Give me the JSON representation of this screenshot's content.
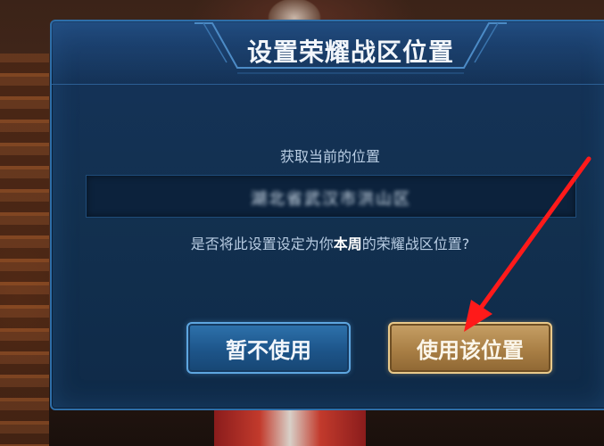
{
  "dialog": {
    "title": "设置荣耀战区位置",
    "prompt": "获取当前的位置",
    "location_value": "湖北省武汉市洪山区",
    "question_prefix": "是否将此设置设定为你",
    "question_highlight": "本周",
    "question_suffix": "的荣耀战区位置?",
    "cancel_label": "暂不使用",
    "confirm_label": "使用该位置"
  },
  "colors": {
    "dialog_bg": "#12304f",
    "dialog_border": "#2e6ea8",
    "cancel_button": "#1d558a",
    "confirm_button": "#a97f45",
    "annotation_arrow": "#ff1a1a"
  },
  "icons": {
    "annotation": "arrow-icon"
  }
}
